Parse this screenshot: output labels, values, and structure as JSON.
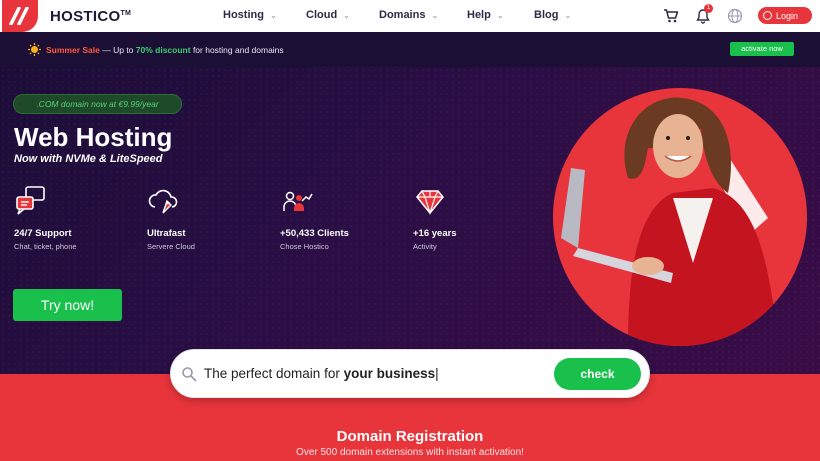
{
  "nav": {
    "brand": "HOSTICO",
    "brand_tm": "TM",
    "menu": [
      {
        "label": "Hosting"
      },
      {
        "label": "Cloud"
      },
      {
        "label": "Domains"
      },
      {
        "label": "Help"
      },
      {
        "label": "Blog"
      }
    ],
    "notification_count": "1",
    "login_label": "Login"
  },
  "promo": {
    "sale": "Summer Sale",
    "middle": " — Up to ",
    "discount": "70% discount",
    "tail": " for hosting and domains",
    "cta": "activate now"
  },
  "hero": {
    "pill": ".COM domain now at €9.99/year",
    "title": "Web Hosting",
    "subtitle": "Now with NVMe & LiteSpeed",
    "features": [
      {
        "title": "24/7 Support",
        "desc": "Chat, ticket, phone",
        "icon": "chat-support-icon"
      },
      {
        "title": "Ultrafast",
        "desc": "Servere Cloud",
        "icon": "cloud-rocket-icon"
      },
      {
        "title": "+50,433 Clients",
        "desc": "Chose Hostico",
        "icon": "clients-growth-icon"
      },
      {
        "title": "+16 years",
        "desc": "Activity",
        "icon": "diamond-icon"
      }
    ],
    "cta": "Try now!"
  },
  "search": {
    "prefix": "The perfect domain for ",
    "emphasis": "your business",
    "caret": "|",
    "button": "check"
  },
  "section": {
    "title": "Domain Registration",
    "subtitle": "Over 500 domain extensions with instant activation!"
  },
  "colors": {
    "brand_red": "#e8343b",
    "cta_green": "#19c04b",
    "hero_bg": "#1c0d38"
  }
}
